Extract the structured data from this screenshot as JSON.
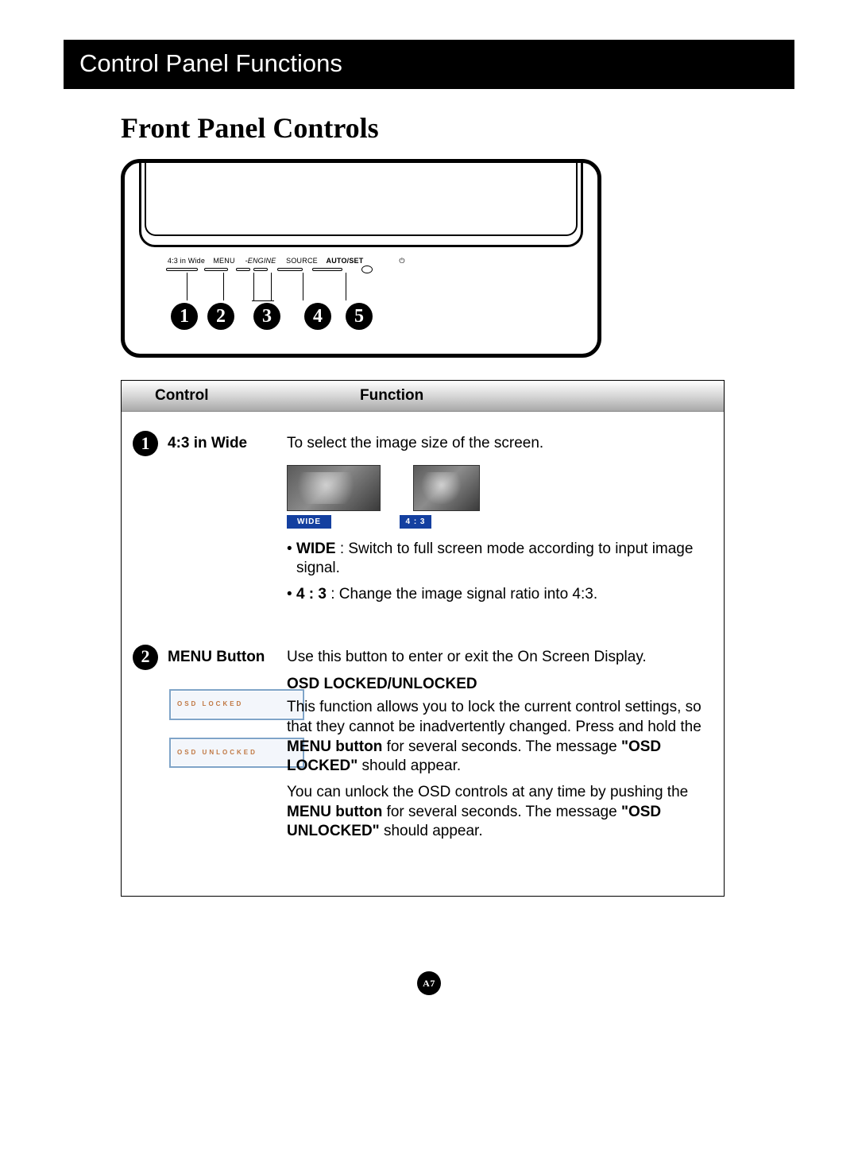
{
  "header": {
    "title": "Control Panel Functions"
  },
  "heading": "Front Panel Controls",
  "diagram": {
    "button_labels": {
      "b1": "4:3 in Wide",
      "b2": "MENU",
      "b3": "-ENGINE",
      "b4": "SOURCE",
      "b5": "AUTO/SET",
      "b6": "⏻"
    },
    "callouts": [
      "1",
      "2",
      "3",
      "4",
      "5"
    ]
  },
  "table": {
    "head": {
      "control": "Control",
      "function": "Function"
    },
    "rows": [
      {
        "num": "1",
        "control": "4:3 in Wide",
        "lead": "To select the image size of the screen.",
        "thumbs": [
          {
            "chip": "WIDE"
          },
          {
            "chip": "4 : 3"
          }
        ],
        "bullets": [
          {
            "label": "WIDE",
            "text": " : Switch to full screen mode according to input image signal."
          },
          {
            "label": "4 : 3",
            "text": " : Change the image signal ratio into 4:3."
          }
        ]
      },
      {
        "num": "2",
        "control": "MENU Button",
        "lead": "Use this button to enter or exit the On Screen Display.",
        "subhead": "OSD LOCKED/UNLOCKED",
        "osd_boxes": [
          "OSD LOCKED",
          "OSD UNLOCKED"
        ],
        "para1a": "This function allows you to lock the current control settings, so that they cannot be inadvertently changed. Press and hold the ",
        "para1b": "MENU button",
        "para1c": " for several seconds. The message ",
        "para1d": "\"OSD LOCKED\"",
        "para1e": " should appear.",
        "para2a": "You can unlock the OSD controls at any time by pushing the ",
        "para2b": "MENU button",
        "para2c": " for several seconds. The message ",
        "para2d": "\"OSD UNLOCKED\"",
        "para2e": " should appear."
      }
    ]
  },
  "page_number": "A7"
}
